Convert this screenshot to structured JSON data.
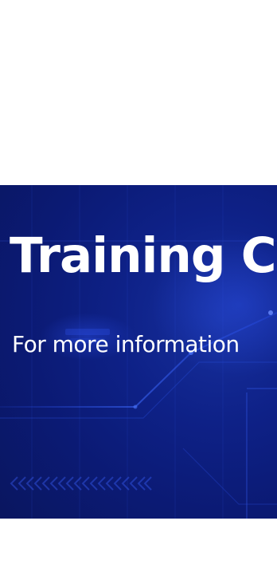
{
  "hero": {
    "title": "Training C",
    "subtitle": "For more information",
    "background_color": "#0b1a74",
    "accent_color": "#2a55ff",
    "text_color": "#ffffff"
  }
}
